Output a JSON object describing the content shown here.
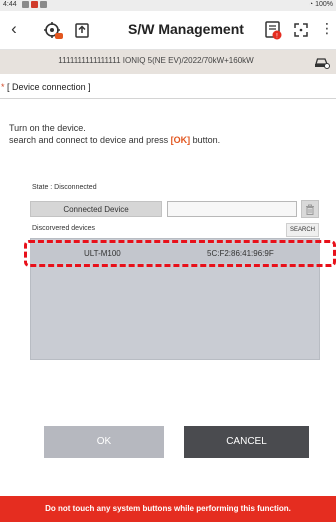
{
  "status_bar": {
    "time": "4:44",
    "battery": "100%"
  },
  "app_bar": {
    "title": "S/W Management",
    "back_icon": "chevron-left-icon"
  },
  "vehicle": {
    "info": "1111111111111111  IONIQ 5(NE EV)/2022/70kW+160kW"
  },
  "section": {
    "title": "[ Device connection ]"
  },
  "instructions": {
    "line1": "Turn on the device.",
    "line2_before": "search and connect to device and press ",
    "ok_word": "[OK]",
    "line2_after": " button."
  },
  "connection": {
    "state": "State : Disconnected",
    "connected_label": "Connected Device",
    "connected_value": ""
  },
  "discovered": {
    "label": "Discorvered devices",
    "search_label": "SEARCH",
    "devices": [
      {
        "name": "ULT-M100",
        "mac": "5C:F2:86:41:96:9F"
      }
    ]
  },
  "buttons": {
    "ok": "OK",
    "cancel": "CANCEL"
  },
  "warning": "Do not touch any system buttons while performing this function.",
  "colors": {
    "accent": "#e2561f",
    "warning_bg": "#e52d20",
    "highlight": "#e8101a"
  }
}
